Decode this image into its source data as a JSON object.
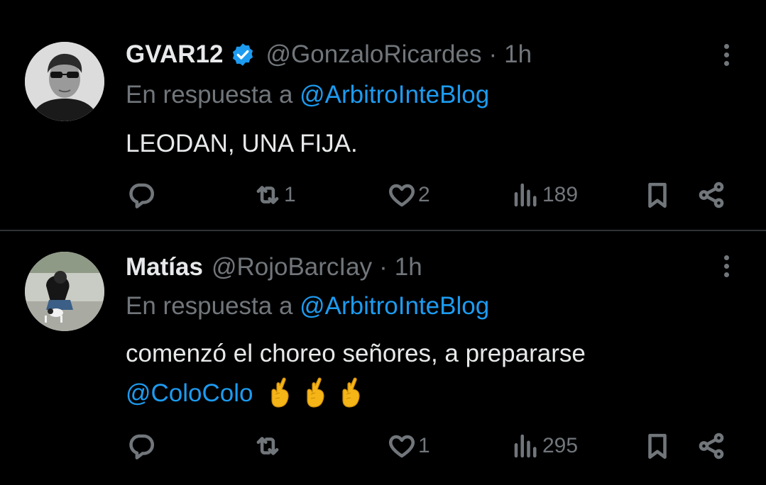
{
  "tweets": [
    {
      "name": "GVAR12",
      "handle": "@GonzaloRicardes",
      "separator": "·",
      "time": "1h",
      "verified": true,
      "reply_prefix": "En respuesta a ",
      "reply_to": "@ArbitroInteBlog",
      "text": "LEODAN, UNA FIJA.",
      "counts": {
        "reply": "",
        "retweet": "1",
        "like": "2",
        "views": "189"
      }
    },
    {
      "name": "Matías",
      "handle": "@RojoBarcIay",
      "separator": "·",
      "time": "1h",
      "verified": false,
      "reply_prefix": "En respuesta a ",
      "reply_to": "@ArbitroInteBlog",
      "text_line1": "comenzó el choreo señores, a prepararse",
      "text_mention": "@ColoColo",
      "emoji": "crossed-fingers",
      "counts": {
        "reply": "",
        "retweet": "",
        "like": "1",
        "views": "295"
      }
    }
  ],
  "colors": {
    "background": "#000000",
    "text": "#e7e9ea",
    "secondary": "#71767b",
    "link": "#1d9bf0",
    "divider": "#2f3336"
  },
  "icons": [
    "reply-icon",
    "retweet-icon",
    "like-icon",
    "views-icon",
    "bookmark-icon",
    "share-icon",
    "more-icon",
    "verified-badge-icon"
  ]
}
